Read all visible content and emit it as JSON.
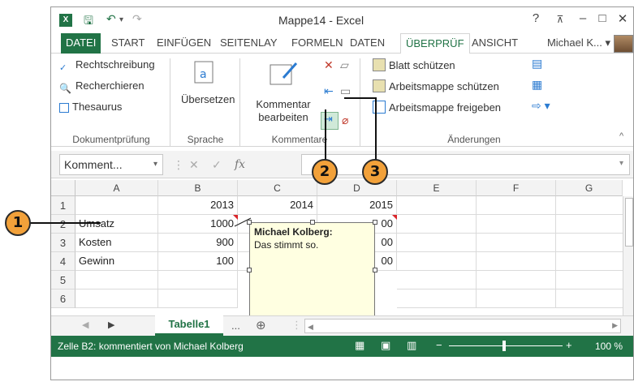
{
  "window": {
    "title": "Mappe14 - Excel",
    "help": "?",
    "minimize": "–",
    "maximize": "□",
    "close": "✕"
  },
  "quick_access": {
    "save": "🖫",
    "undo": "↶",
    "redo": "↷",
    "more": "▾"
  },
  "tabs": [
    "DATEI",
    "START",
    "EINFÜGEN",
    "SEITENLAY",
    "FORMELN",
    "DATEN",
    "ÜBERPRÜF",
    "ANSICHT"
  ],
  "user": "Michael K...",
  "ribbon": {
    "dokumentpruefung": {
      "items": [
        "Rechtschreibung",
        "Recherchieren",
        "Thesaurus"
      ],
      "label": "Dokumentprüfung"
    },
    "sprache": {
      "button": "Übersetzen",
      "label": "Sprache"
    },
    "kommentare": {
      "button_line1": "Kommentar",
      "button_line2": "bearbeiten",
      "label": "Kommentare"
    },
    "aenderungen": {
      "items": [
        "Blatt schützen",
        "Arbeitsmappe schützen",
        "Arbeitsmappe freigeben"
      ],
      "label": "Änderungen"
    }
  },
  "formula_bar": {
    "name_box": "Komment...",
    "fx": "fx"
  },
  "columns": [
    "A",
    "B",
    "C",
    "D",
    "E",
    "F",
    "G"
  ],
  "rows": [
    {
      "n": "1",
      "a": "",
      "b": "2013",
      "c": "2014",
      "d": "2015"
    },
    {
      "n": "2",
      "a": "Umsatz",
      "b": "1000",
      "c": "",
      "d": "00"
    },
    {
      "n": "3",
      "a": "Kosten",
      "b": "900",
      "c": "",
      "d": "00"
    },
    {
      "n": "4",
      "a": "Gewinn",
      "b": "100",
      "c": "",
      "d": "00"
    },
    {
      "n": "5",
      "a": "",
      "b": "",
      "c": "",
      "d": ""
    },
    {
      "n": "6",
      "a": "",
      "b": "",
      "c": "",
      "d": ""
    }
  ],
  "comment": {
    "author": "Michael Kolberg:",
    "text": "Das stimmt so."
  },
  "sheet": {
    "tab": "Tabelle1",
    "more": "...",
    "add": "⊕"
  },
  "status": {
    "text": "Zelle B2: kommentiert von Michael Kolberg",
    "zoom": "100 %"
  },
  "callouts": [
    "1",
    "2",
    "3"
  ]
}
